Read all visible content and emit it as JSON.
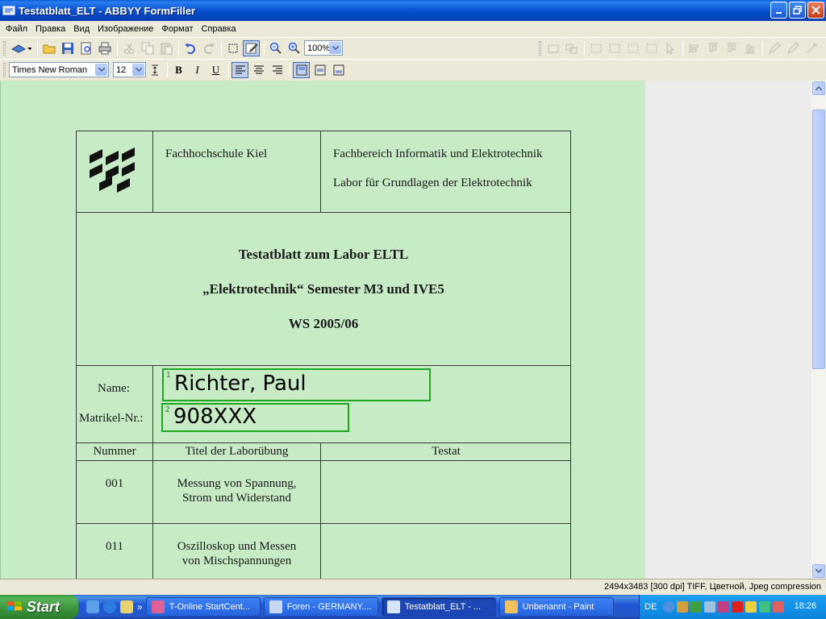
{
  "window": {
    "title": "Testatblatt_ELT - ABBYY FormFiller",
    "buttons": [
      "minimize-icon",
      "restore-icon",
      "close-icon"
    ]
  },
  "menu": [
    "Файл",
    "Правка",
    "Вид",
    "Изображение",
    "Формат",
    "Справка"
  ],
  "toolbar1": {
    "zoom": "100%",
    "icons": [
      "scan-icon",
      "open-icon",
      "save-icon",
      "preview-icon",
      "print-icon",
      "cut-icon",
      "copy-icon",
      "paste-icon",
      "undo-icon",
      "redo-icon",
      "select-icon",
      "edit-icon",
      "zoom-out-icon",
      "zoom-in-icon"
    ]
  },
  "toolbar2": {
    "font": "Times New Roman",
    "size": "12",
    "bold": "B",
    "italic": "I",
    "underline": "U"
  },
  "document": {
    "header": {
      "school": "Fachhochschule Kiel",
      "department": "Fachbereich Informatik und Elektrotechnik",
      "lab": "Labor für Grundlagen der Elektrotechnik"
    },
    "title_lines": [
      "Testatblatt zum Labor ELTL",
      "„Elektrotechnik“    Semester M3 und IVE5",
      "WS 2005/06"
    ],
    "fields": [
      {
        "label": "Name:",
        "index": "1",
        "value": "Richter, Paul"
      },
      {
        "label": "Matrikel-Nr.:",
        "index": "2",
        "value": "908XXX"
      }
    ],
    "columns": [
      "Nummer",
      "Titel der Laborübung",
      "Testat"
    ],
    "rows": [
      {
        "number": "001",
        "title_l1": "Messung von Spannung,",
        "title_l2": "Strom und Widerstand"
      },
      {
        "number": "011",
        "title_l1": "Oszilloskop und Messen",
        "title_l2": "von Mischspannungen"
      }
    ]
  },
  "status": "2494x3483 [300 dpi] TIFF, Цветной, Jpeg compression",
  "taskbar": {
    "start": "Start",
    "tasks": [
      {
        "label": "T-Online StartCent..."
      },
      {
        "label": "Foren - GERMANY...."
      },
      {
        "label": "Testatblatt_ELT - ..."
      },
      {
        "label": "Unbenannt - Paint"
      }
    ],
    "lang": "DE",
    "clock": "18:26",
    "overflow": "»"
  },
  "colors": {
    "page_bg": "#c6ebc5",
    "ocr_box": "#1fa81f",
    "titlebar": "#0c56d6"
  }
}
